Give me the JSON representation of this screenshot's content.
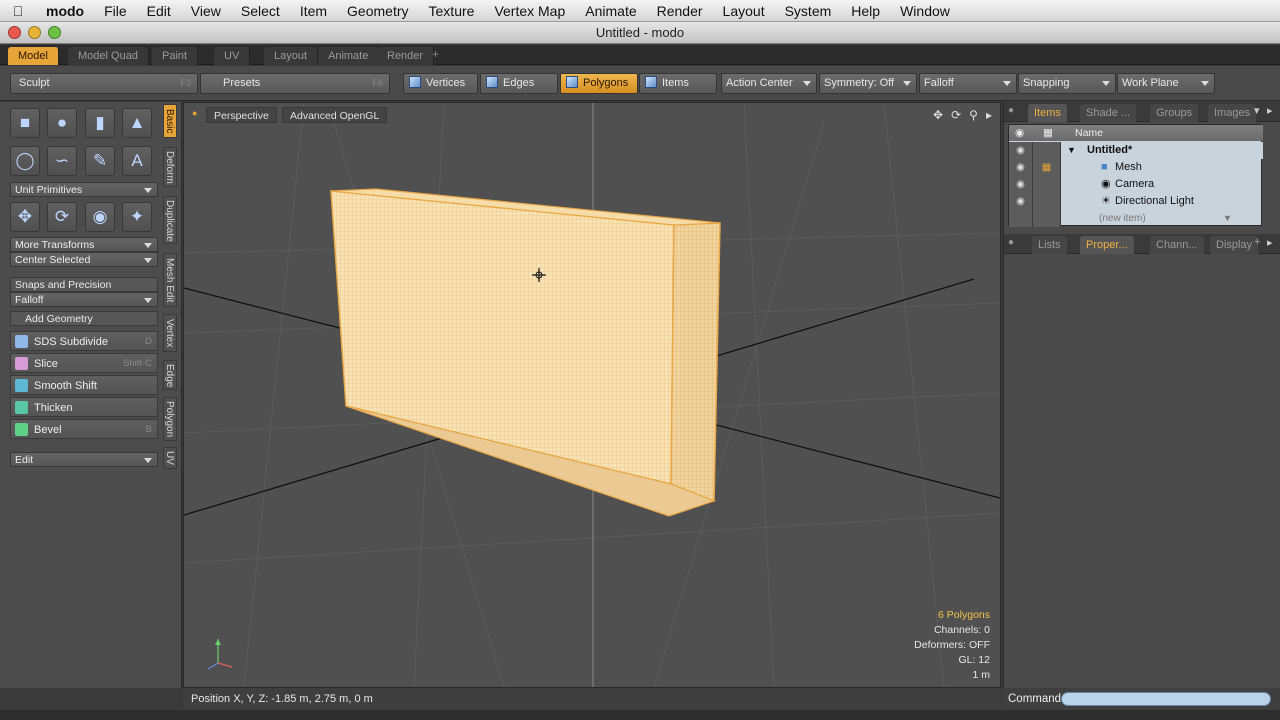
{
  "menubar": {
    "app": "modo",
    "items": [
      "File",
      "Edit",
      "View",
      "Select",
      "Item",
      "Geometry",
      "Texture",
      "Vertex Map",
      "Animate",
      "Render",
      "Layout",
      "System",
      "Help",
      "Window"
    ]
  },
  "window": {
    "title": "Untitled - modo"
  },
  "layout_tabs": [
    "Model",
    "Model Quad",
    "Paint",
    "UV",
    "Layout",
    "Animate",
    "Render"
  ],
  "toolbar": {
    "sculpt": {
      "label": "Sculpt",
      "key": "F3"
    },
    "presets": {
      "label": "Presets",
      "key": "F6"
    },
    "modes": [
      "Vertices",
      "Edges",
      "Polygons",
      "Items"
    ],
    "dropdowns": [
      "Action Center",
      "Symmetry: Off",
      "Falloff",
      "Snapping",
      "Work Plane"
    ]
  },
  "left_panel": {
    "unit_primitives": "Unit Primitives",
    "more_transforms": "More Transforms",
    "center_selected": "Center Selected",
    "snaps_and_precision": "Snaps and Precision",
    "falloff": "Falloff",
    "add_geometry": "Add Geometry",
    "tools": [
      {
        "label": "SDS Subdivide",
        "key": "D"
      },
      {
        "label": "Slice",
        "key": "Shift-C"
      },
      {
        "label": "Smooth Shift",
        "key": ""
      },
      {
        "label": "Thicken",
        "key": ""
      },
      {
        "label": "Bevel",
        "key": "B"
      }
    ],
    "edit": "Edit"
  },
  "vertical_tabs": [
    "Basic",
    "Deform",
    "Duplicate",
    "Mesh Edit",
    "Vertex",
    "Edge",
    "Polygon",
    "UV"
  ],
  "viewport": {
    "view": "Perspective",
    "render_mode": "Advanced OpenGL",
    "stats": {
      "polygons": "6 Polygons",
      "channels": "Channels: 0",
      "deformers": "Deformers: OFF",
      "gl": "GL: 12",
      "scale": "1 m"
    }
  },
  "status": {
    "position": "Position X, Y, Z:   -1.85 m, 2.75 m, 0 m"
  },
  "right_panel": {
    "top_tabs": [
      "Items",
      "Shade ...",
      "Groups",
      "Images"
    ],
    "column_name": "Name",
    "items": [
      {
        "label": "Untitled*",
        "kind": "scene"
      },
      {
        "label": "Mesh",
        "kind": "mesh"
      },
      {
        "label": "Camera",
        "kind": "camera"
      },
      {
        "label": "Directional Light",
        "kind": "light"
      },
      {
        "label": "(new item)",
        "kind": "placeholder"
      }
    ],
    "bottom_tabs": [
      "Lists",
      "Proper...",
      "Chann...",
      "Display"
    ]
  },
  "command": {
    "label": "Command",
    "value": ""
  },
  "colors": {
    "accent": "#e7a438",
    "mesh_fill": "#f7dfae",
    "mesh_wire": "#e9a847",
    "viewport_bg": "#505050"
  }
}
